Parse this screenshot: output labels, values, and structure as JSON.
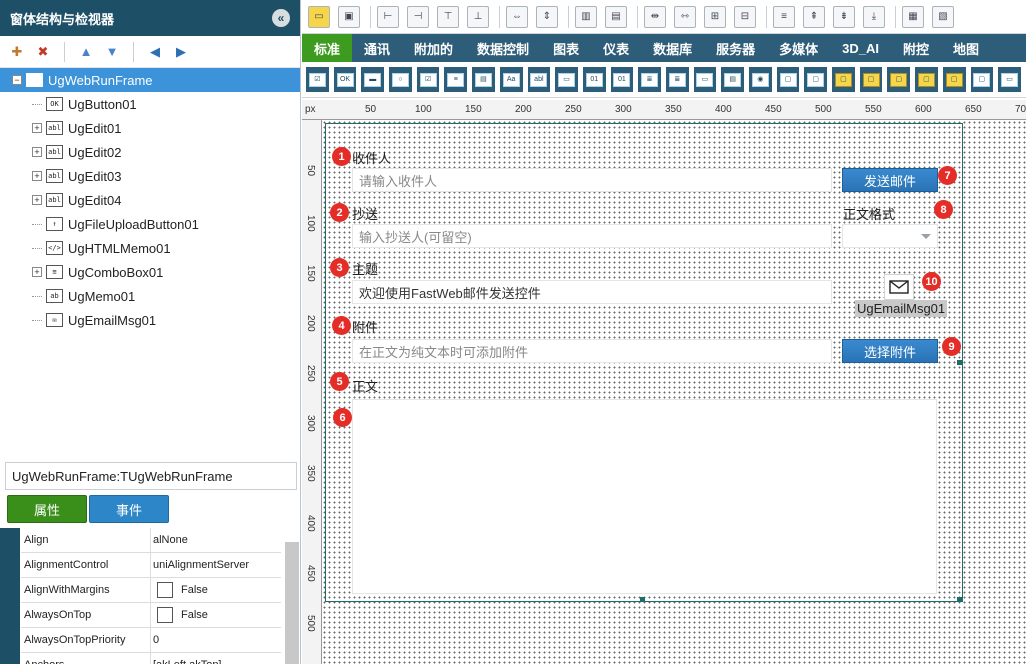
{
  "left_panel": {
    "title": "窗体结构与检视器",
    "collapse_icon": "«",
    "tree": [
      {
        "label": "UgWebRunFrame",
        "icon_text": "",
        "level": 0,
        "expander": "−",
        "selected": true
      },
      {
        "label": "UgButton01",
        "icon_text": "OK",
        "level": 1,
        "expander": "",
        "selected": false
      },
      {
        "label": "UgEdit01",
        "icon_text": "abl",
        "level": 1,
        "expander": "+",
        "selected": false
      },
      {
        "label": "UgEdit02",
        "icon_text": "abl",
        "level": 1,
        "expander": "+",
        "selected": false
      },
      {
        "label": "UgEdit03",
        "icon_text": "abl",
        "level": 1,
        "expander": "+",
        "selected": false
      },
      {
        "label": "UgEdit04",
        "icon_text": "abl",
        "level": 1,
        "expander": "+",
        "selected": false
      },
      {
        "label": "UgFileUploadButton01",
        "icon_text": "↑",
        "level": 1,
        "expander": "",
        "selected": false
      },
      {
        "label": "UgHTMLMemo01",
        "icon_text": "</>",
        "level": 1,
        "expander": "",
        "selected": false
      },
      {
        "label": "UgComboBox01",
        "icon_text": "≡",
        "level": 1,
        "expander": "+",
        "selected": false
      },
      {
        "label": "UgMemo01",
        "icon_text": "ab",
        "level": 1,
        "expander": "",
        "selected": false
      },
      {
        "label": "UgEmailMsg01",
        "icon_text": "✉",
        "level": 1,
        "expander": "",
        "selected": false
      }
    ],
    "frame_name": "UgWebRunFrame:TUgWebRunFrame",
    "tab_properties": "属性",
    "tab_events": "事件",
    "properties": [
      {
        "name": "Align",
        "value": "alNone",
        "checkbox": false
      },
      {
        "name": "AlignmentControl",
        "value": "uniAlignmentServer",
        "checkbox": false
      },
      {
        "name": "AlignWithMargins",
        "value": "False",
        "checkbox": true
      },
      {
        "name": "AlwaysOnTop",
        "value": "False",
        "checkbox": true
      },
      {
        "name": "AlwaysOnTopPriority",
        "value": "0",
        "checkbox": false
      },
      {
        "name": "Anchors",
        "value": "[akLeft,akTop]",
        "checkbox": false
      }
    ]
  },
  "main_tabs": [
    "标准",
    "通讯",
    "附加的",
    "数据控制",
    "图表",
    "仪表",
    "数据库",
    "服务器",
    "多媒体",
    "3D_AI",
    "附控",
    "地图"
  ],
  "ruler": {
    "unit": "px",
    "h_ticks": [
      "50",
      "100",
      "150",
      "200",
      "250",
      "300",
      "350",
      "400",
      "450",
      "500",
      "550",
      "600",
      "650",
      "700"
    ],
    "v_ticks": [
      "50",
      "100",
      "150",
      "200",
      "250",
      "300",
      "350",
      "400",
      "450",
      "500"
    ]
  },
  "form": {
    "recipient_label": "收件人",
    "recipient_placeholder": "请输入收件人",
    "cc_label": "抄送",
    "cc_placeholder": "输入抄送人(可留空)",
    "subject_label": "主题",
    "subject_value": "欢迎使用FastWeb邮件发送控件",
    "attach_label": "附件",
    "attach_placeholder": "在正文为纯文本时可添加附件",
    "body_label": "正文",
    "send_button": "发送邮件",
    "format_label": "正文格式",
    "attach_button": "选择附件",
    "email_component_label": "UgEmailMsg01"
  },
  "badges": [
    "1",
    "2",
    "3",
    "4",
    "5",
    "6",
    "7",
    "8",
    "9",
    "10"
  ],
  "colors": {
    "header": "#1d4f67",
    "tab_bar": "#2d5d78",
    "active_tab": "#3d9c1f",
    "selection": "#3c93da",
    "button": "#2d86c7",
    "badge": "#e52d27"
  }
}
